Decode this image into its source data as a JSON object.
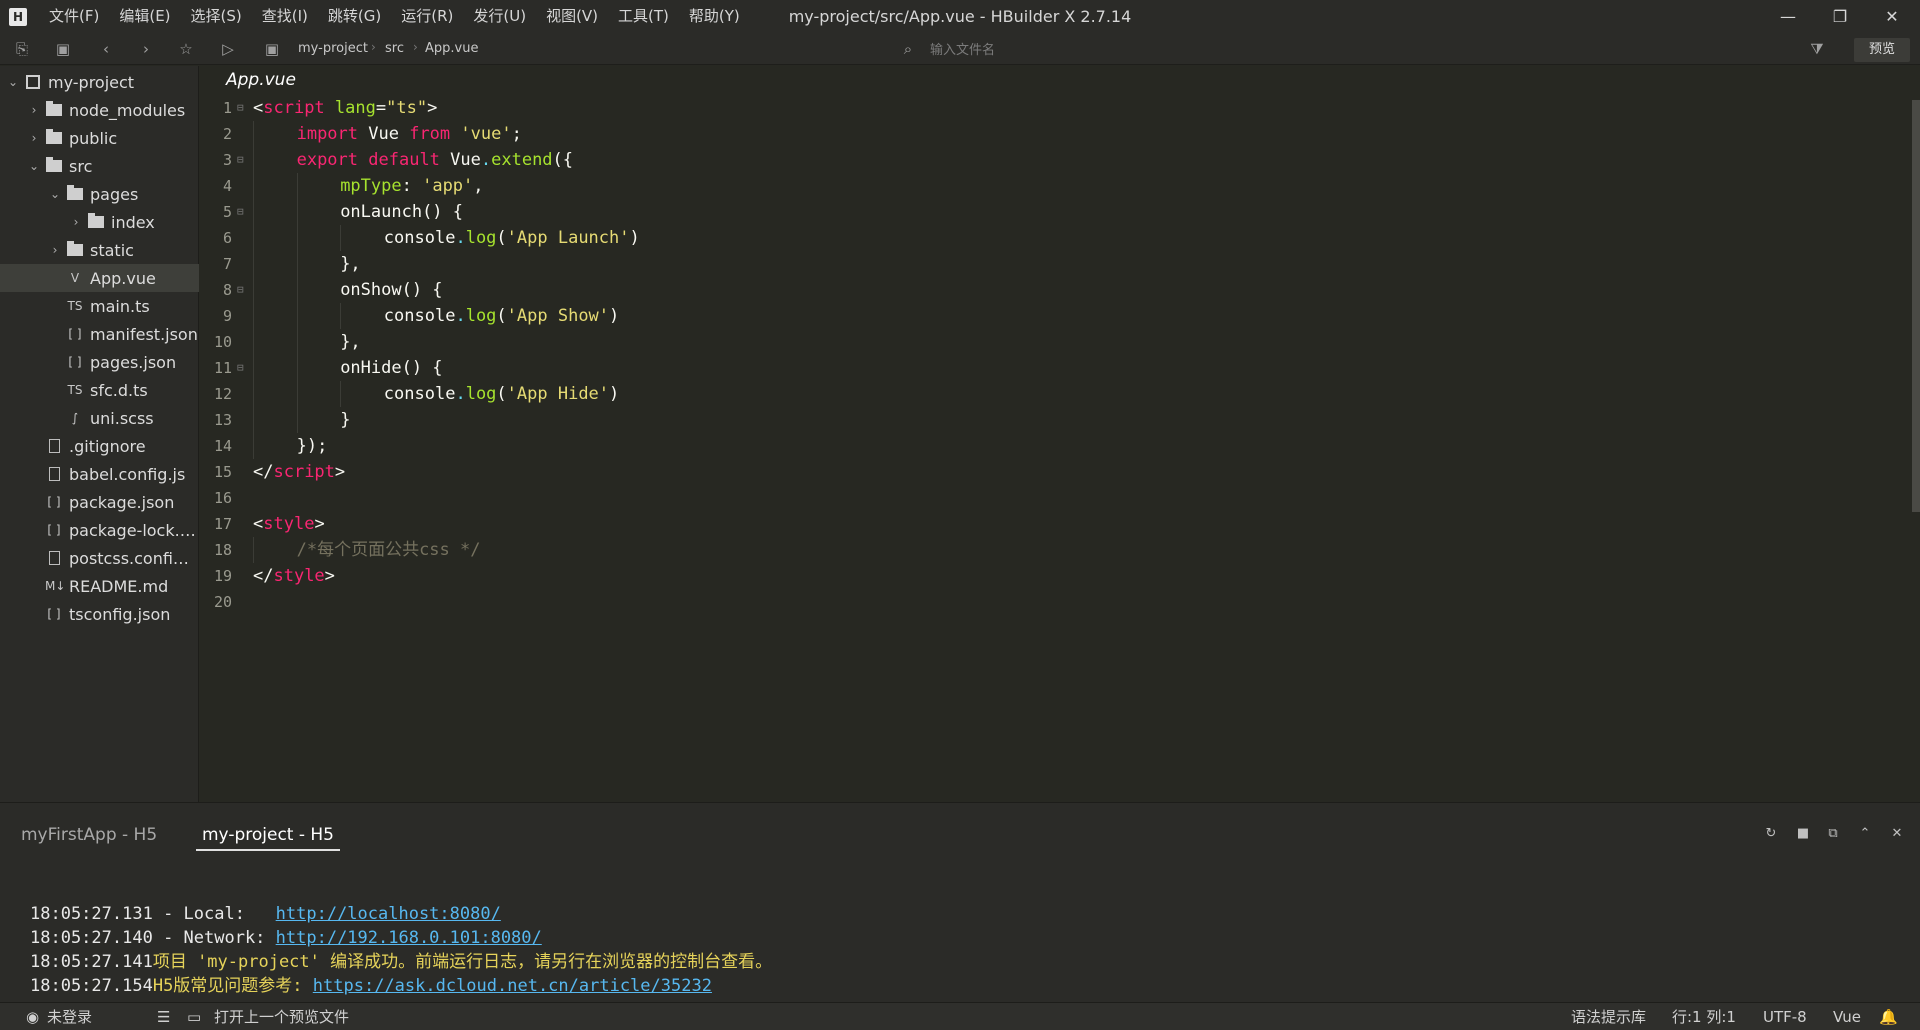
{
  "app": {
    "window_title": "my-project/src/App.vue - HBuilder X 2.7.14",
    "logo": "H"
  },
  "menu": [
    "文件(F)",
    "编辑(E)",
    "选择(S)",
    "查找(I)",
    "跳转(G)",
    "运行(R)",
    "发行(U)",
    "视图(V)",
    "工具(T)",
    "帮助(Y)"
  ],
  "window_controls": {
    "minimize": "—",
    "maximize": "❐",
    "close": "✕"
  },
  "toolbar": {
    "breadcrumb": [
      "my-project",
      "src",
      "App.vue"
    ],
    "search_placeholder": "输入文件名",
    "preview_label": "预览"
  },
  "sidebar": {
    "items": [
      {
        "label": "my-project",
        "kind": "project",
        "expanded": true
      },
      {
        "label": "node_modules",
        "kind": "folder",
        "expanded": false
      },
      {
        "label": "public",
        "kind": "folder",
        "expanded": false
      },
      {
        "label": "src",
        "kind": "folder",
        "expanded": true
      },
      {
        "label": "pages",
        "kind": "folder",
        "expanded": true
      },
      {
        "label": "index",
        "kind": "folder",
        "expanded": false
      },
      {
        "label": "static",
        "kind": "folder",
        "expanded": false
      },
      {
        "label": "App.vue",
        "kind": "vue",
        "icon": "V"
      },
      {
        "label": "main.ts",
        "kind": "ts",
        "icon": "TS"
      },
      {
        "label": "manifest.json",
        "kind": "json",
        "icon": "[ ]"
      },
      {
        "label": "pages.json",
        "kind": "json",
        "icon": "[ ]"
      },
      {
        "label": "sfc.d.ts",
        "kind": "ts",
        "icon": "TS"
      },
      {
        "label": "uni.scss",
        "kind": "scss",
        "icon": "∫"
      },
      {
        "label": ".gitignore",
        "kind": "file",
        "icon": ""
      },
      {
        "label": "babel.config.js",
        "kind": "file",
        "icon": ""
      },
      {
        "label": "package.json",
        "kind": "json",
        "icon": "[ ]"
      },
      {
        "label": "package-lock.j...",
        "kind": "json",
        "icon": "[ ]"
      },
      {
        "label": "postcss.config.js",
        "kind": "file",
        "icon": ""
      },
      {
        "label": "README.md",
        "kind": "md",
        "icon": "M↓"
      },
      {
        "label": "tsconfig.json",
        "kind": "json",
        "icon": "[ ]"
      }
    ],
    "active_index": 7
  },
  "editor": {
    "tab_label": "App.vue",
    "lines": [
      {
        "n": "1",
        "fold": true,
        "indent": 0,
        "tokens": [
          [
            "t-punc",
            "<"
          ],
          [
            "t-tag",
            "script"
          ],
          [
            "t-punc",
            " "
          ],
          [
            "t-attr",
            "lang"
          ],
          [
            "t-punc",
            "="
          ],
          [
            "t-str",
            "\"ts\""
          ],
          [
            "t-punc",
            ">"
          ]
        ]
      },
      {
        "n": "2",
        "fold": false,
        "indent": 1,
        "tokens": [
          [
            "t-kw",
            "import"
          ],
          [
            "t-plain",
            " Vue "
          ],
          [
            "t-kw",
            "from"
          ],
          [
            "t-plain",
            " "
          ],
          [
            "t-str",
            "'vue'"
          ],
          [
            "t-punc",
            ";"
          ]
        ]
      },
      {
        "n": "3",
        "fold": true,
        "indent": 1,
        "tokens": [
          [
            "t-kw",
            "export"
          ],
          [
            "t-plain",
            " "
          ],
          [
            "t-kw",
            "default"
          ],
          [
            "t-plain",
            " Vue"
          ],
          [
            "t-dot",
            "."
          ],
          [
            "t-fn",
            "extend"
          ],
          [
            "t-punc",
            "({"
          ]
        ]
      },
      {
        "n": "4",
        "fold": false,
        "indent": 2,
        "tokens": [
          [
            "t-prop",
            "mpType"
          ],
          [
            "t-punc",
            ": "
          ],
          [
            "t-str",
            "'app'"
          ],
          [
            "t-punc",
            ","
          ]
        ]
      },
      {
        "n": "5",
        "fold": true,
        "indent": 2,
        "tokens": [
          [
            "t-plain",
            "onLaunch() {"
          ]
        ]
      },
      {
        "n": "6",
        "fold": false,
        "indent": 3,
        "tokens": [
          [
            "t-obj",
            "console"
          ],
          [
            "t-dot",
            "."
          ],
          [
            "t-fn",
            "log"
          ],
          [
            "t-punc",
            "("
          ],
          [
            "t-str",
            "'App Launch'"
          ],
          [
            "t-punc",
            ")"
          ]
        ]
      },
      {
        "n": "7",
        "fold": false,
        "indent": 2,
        "tokens": [
          [
            "t-punc",
            "},"
          ]
        ]
      },
      {
        "n": "8",
        "fold": true,
        "indent": 2,
        "tokens": [
          [
            "t-plain",
            "onShow() {"
          ]
        ]
      },
      {
        "n": "9",
        "fold": false,
        "indent": 3,
        "tokens": [
          [
            "t-obj",
            "console"
          ],
          [
            "t-dot",
            "."
          ],
          [
            "t-fn",
            "log"
          ],
          [
            "t-punc",
            "("
          ],
          [
            "t-str",
            "'App Show'"
          ],
          [
            "t-punc",
            ")"
          ]
        ]
      },
      {
        "n": "10",
        "fold": false,
        "indent": 2,
        "tokens": [
          [
            "t-punc",
            "},"
          ]
        ]
      },
      {
        "n": "11",
        "fold": true,
        "indent": 2,
        "tokens": [
          [
            "t-plain",
            "onHide() {"
          ]
        ]
      },
      {
        "n": "12",
        "fold": false,
        "indent": 3,
        "tokens": [
          [
            "t-obj",
            "console"
          ],
          [
            "t-dot",
            "."
          ],
          [
            "t-fn",
            "log"
          ],
          [
            "t-punc",
            "("
          ],
          [
            "t-str",
            "'App Hide'"
          ],
          [
            "t-punc",
            ")"
          ]
        ]
      },
      {
        "n": "13",
        "fold": false,
        "indent": 2,
        "tokens": [
          [
            "t-punc",
            "}"
          ]
        ]
      },
      {
        "n": "14",
        "fold": false,
        "indent": 1,
        "tokens": [
          [
            "t-punc",
            "});"
          ]
        ]
      },
      {
        "n": "15",
        "fold": false,
        "indent": 0,
        "tokens": [
          [
            "t-punc",
            "</"
          ],
          [
            "t-tag",
            "script"
          ],
          [
            "t-punc",
            ">"
          ]
        ]
      },
      {
        "n": "16",
        "fold": false,
        "indent": 0,
        "tokens": []
      },
      {
        "n": "17",
        "fold": false,
        "indent": 0,
        "tokens": [
          [
            "t-punc",
            "<"
          ],
          [
            "t-tag",
            "style"
          ],
          [
            "t-punc",
            ">"
          ]
        ]
      },
      {
        "n": "18",
        "fold": false,
        "indent": 1,
        "tokens": [
          [
            "t-com",
            "/*每个页面公共css */"
          ]
        ]
      },
      {
        "n": "19",
        "fold": false,
        "indent": 0,
        "tokens": [
          [
            "t-punc",
            "</"
          ],
          [
            "t-tag",
            "style"
          ],
          [
            "t-punc",
            ">"
          ]
        ]
      },
      {
        "n": "20",
        "fold": false,
        "indent": 0,
        "tokens": []
      }
    ]
  },
  "console": {
    "tabs": [
      "myFirstApp - H5",
      "my-project - H5"
    ],
    "active_tab": 1,
    "log": [
      {
        "time": "18:05:27.131",
        "parts": [
          [
            "log-text",
            " - Local:   "
          ],
          [
            "log-link",
            "http://localhost:8080/"
          ]
        ]
      },
      {
        "time": "18:05:27.140",
        "parts": [
          [
            "log-text",
            " - Network: "
          ],
          [
            "log-link",
            "http://192.168.0.101:8080/"
          ]
        ]
      },
      {
        "time": "18:05:27.141",
        "parts": [
          [
            "log-yellow",
            "项目 'my-project' 编译成功。前端运行日志，请另行在浏览器的控制台查看。"
          ]
        ]
      },
      {
        "time": "18:05:27.154",
        "parts": [
          [
            "log-yellow",
            "H5版常见问题参考: "
          ],
          [
            "log-link",
            "https://ask.dcloud.net.cn/article/35232"
          ]
        ]
      }
    ]
  },
  "statusbar": {
    "login": "未登录",
    "open_prev": "打开上一个预览文件",
    "syntax": "语法提示库",
    "position": "行:1  列:1",
    "encoding": "UTF-8",
    "language": "Vue"
  }
}
